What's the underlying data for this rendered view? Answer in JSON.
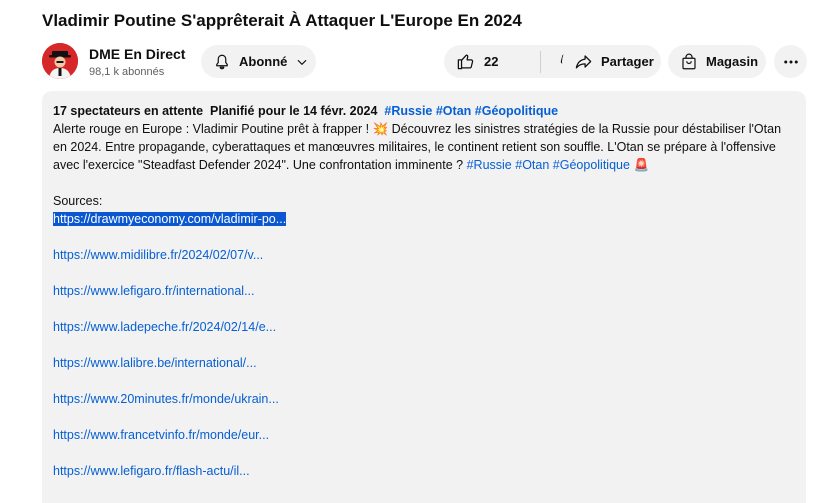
{
  "video": {
    "title": "Vladimir Poutine S'apprêterait À Attaquer L'Europe En 2024"
  },
  "channel": {
    "name": "DME En Direct",
    "subscribers": "98,1 k abonnés",
    "avatar_color": "#d62828"
  },
  "actions": {
    "subscribed_label": "Abonné",
    "like_count": "22",
    "share_label": "Partager",
    "shop_label": "Magasin"
  },
  "description": {
    "waiting": "17 spectateurs en attente",
    "scheduled": "Planifié pour le 14 févr. 2024",
    "meta_tags": [
      "#Russie",
      "#Otan",
      "#Géopolitique"
    ],
    "body": "Alerte rouge en Europe : Vladimir Poutine prêt à frapper ! 💥 Découvrez les sinistres stratégies de la Russie pour déstabiliser l'Otan en 2024. Entre propagande, cyberattaques et manœuvres militaires, le continent retient son souffle. L'Otan se prépare à l'offensive avec l'exercice \"Steadfast Defender 2024\". Une confrontation imminente ?",
    "body_tags": [
      "#Russie",
      "#Otan",
      "#Géopolitique"
    ],
    "body_end_emoji": "🚨",
    "sources_label": "Sources:",
    "links": [
      "https://drawmyeconomy.com/vladimir-po...",
      "https://www.midilibre.fr/2024/02/07/v...",
      "https://www.lefigaro.fr/international...",
      "https://www.ladepeche.fr/2024/02/14/e...",
      "https://www.lalibre.be/international/...",
      "https://www.20minutes.fr/monde/ukrain...",
      "https://www.francetvinfo.fr/monde/eur...",
      "https://www.lefigaro.fr/flash-actu/il..."
    ]
  },
  "colors": {
    "link": "#065fd4",
    "selection": "#0b57d0",
    "pill_bg": "#f2f2f2"
  }
}
